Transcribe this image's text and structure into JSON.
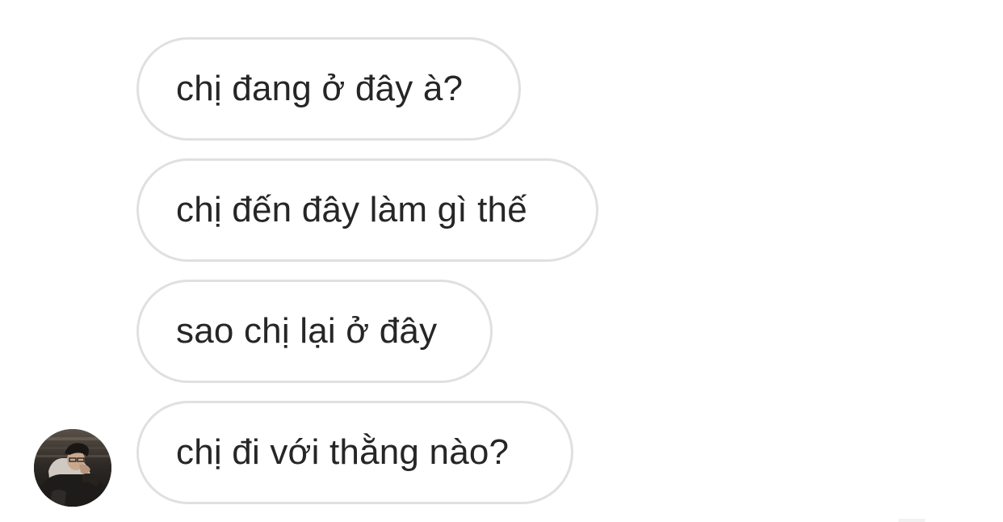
{
  "messages": [
    {
      "text": "chị đang ở đây à?"
    },
    {
      "text": "chị đến đây làm gì thế"
    },
    {
      "text": "sao chị lại ở đây"
    },
    {
      "text": "chị đi với thằng nào?"
    }
  ],
  "sender": {
    "avatar_icon": "profile-photo"
  },
  "colors": {
    "background": "#ffffff",
    "bubble_border": "#e0e0e0",
    "text": "#262626"
  }
}
